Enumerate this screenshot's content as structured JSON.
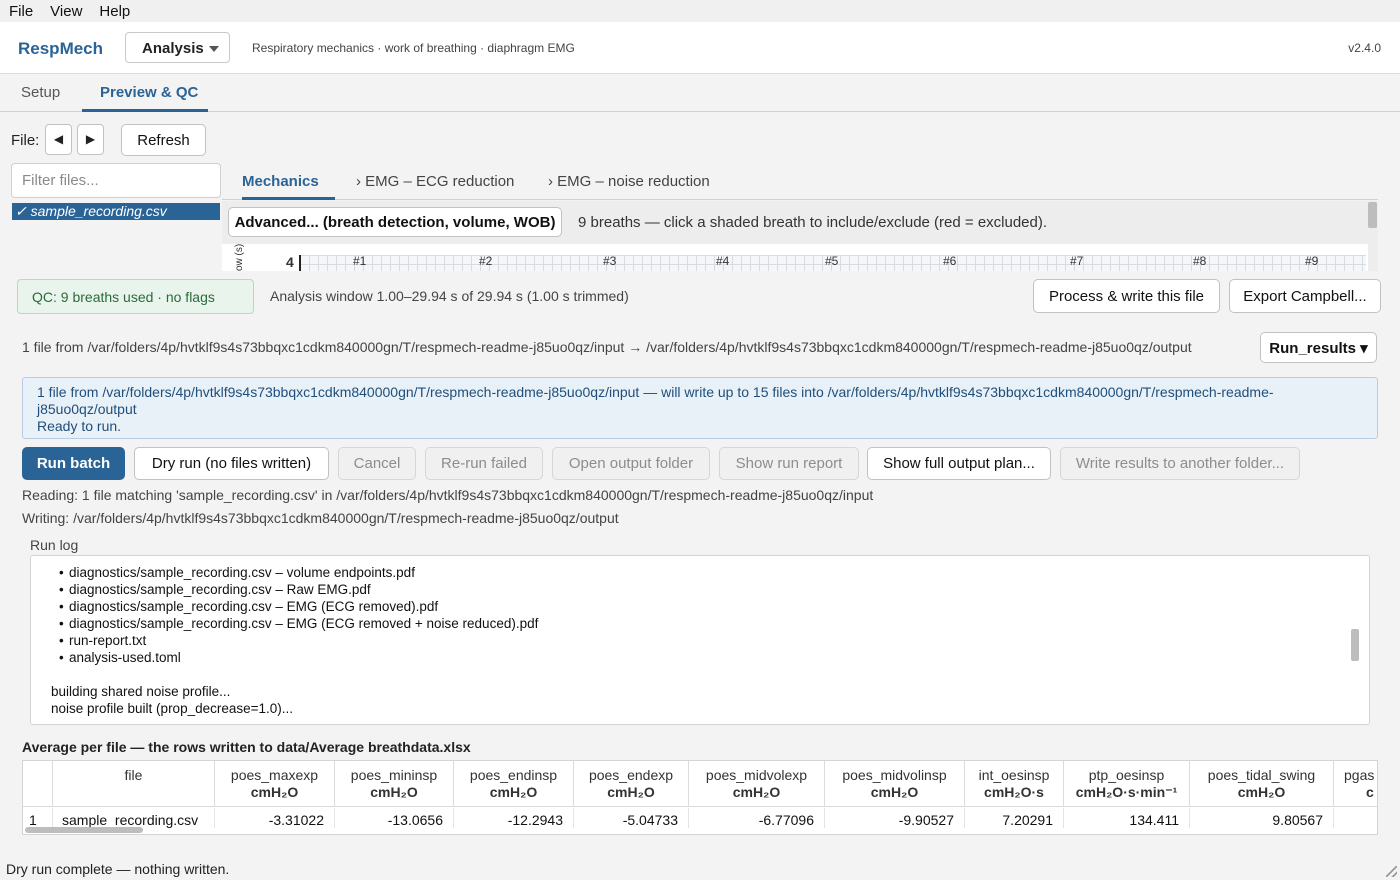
{
  "menu": {
    "items": [
      "File",
      "View",
      "Help"
    ]
  },
  "header": {
    "brand": "RespMech",
    "mode": "Analysis",
    "subtitle": "Respiratory mechanics · work of breathing · diaphragm EMG",
    "version": "v2.4.0"
  },
  "tabs": [
    "Setup",
    "Preview & QC"
  ],
  "file_nav": {
    "label": "File:",
    "prev_icon": "◀",
    "next_icon": "▶",
    "refresh": "Refresh"
  },
  "filter": {
    "placeholder": "Filter files..."
  },
  "files": [
    {
      "name": "✓ sample_recording.csv",
      "selected": true
    }
  ],
  "subtabs": [
    "Mechanics",
    "› EMG – ECG reduction",
    "› EMG – noise reduction"
  ],
  "mechanics": {
    "advanced_button": "Advanced... (breath detection, volume, WOB)",
    "breath_hint": "9 breaths — click a shaded breath to include/exclude (red = excluded).",
    "plot_ylabel": "ow (s)",
    "plot_tick": "4",
    "breath_labels": [
      "#1",
      "#2",
      "#3",
      "#4",
      "#5",
      "#6",
      "#7",
      "#8",
      "#9"
    ]
  },
  "qc": {
    "badge": "QC:  9 breaths used  · no flags",
    "window": "Analysis window 1.00–29.94 s of 29.94 s (1.00 s trimmed)",
    "process_button": "Process & write this file",
    "export_button": "Export Campbell..."
  },
  "batch": {
    "plan_text": "1 file from /var/folders/4p/hvtklf9s4s73bbqxc1cdkm840000gn/T/respmech-readme-j85uo0qz/input → /var/folders/4p/hvtklf9s4s73bbqxc1cdkm840000gn/T/respmech-readme-j85uo0qz/output",
    "run_results_button": "Run_results ▾",
    "info_line1": "1 file from /var/folders/4p/hvtklf9s4s73bbqxc1cdkm840000gn/T/respmech-readme-j85uo0qz/input — will write up to 15 files into /var/folders/4p/hvtklf9s4s73bbqxc1cdkm840000gn/T/respmech-readme-j85uo0qz/output",
    "info_line2": "Ready to run.",
    "buttons": {
      "run": "Run batch",
      "dry_run": "Dry run (no files written)",
      "cancel": "Cancel",
      "rerun_failed": "Re-run failed",
      "open_output": "Open output folder",
      "show_report": "Show run report",
      "show_plan": "Show full output plan...",
      "write_other": "Write results to another folder..."
    },
    "reading": "Reading: 1 file matching 'sample_recording.csv' in /var/folders/4p/hvtklf9s4s73bbqxc1cdkm840000gn/T/respmech-readme-j85uo0qz/input",
    "writing": "Writing: /var/folders/4p/hvtklf9s4s73bbqxc1cdkm840000gn/T/respmech-readme-j85uo0qz/output"
  },
  "runlog": {
    "label": "Run log",
    "bullets": [
      "diagnostics/sample_recording.csv – volume endpoints.pdf",
      "diagnostics/sample_recording.csv – Raw EMG.pdf",
      "diagnostics/sample_recording.csv – EMG (ECG removed).pdf",
      "diagnostics/sample_recording.csv – EMG (ECG removed + noise reduced).pdf",
      "run-report.txt",
      "analysis-used.toml"
    ],
    "lines": [
      "building shared noise profile...",
      "noise profile built (prop_decrease=1.0)..."
    ]
  },
  "table": {
    "title": "Average per file — the rows written to data/Average breathdata.xlsx",
    "columns": [
      {
        "name": "file",
        "unit": ""
      },
      {
        "name": "poes_maxexp",
        "unit": "cmH₂O"
      },
      {
        "name": "poes_mininsp",
        "unit": "cmH₂O"
      },
      {
        "name": "poes_endinsp",
        "unit": "cmH₂O"
      },
      {
        "name": "poes_endexp",
        "unit": "cmH₂O"
      },
      {
        "name": "poes_midvolexp",
        "unit": "cmH₂O"
      },
      {
        "name": "poes_midvolinsp",
        "unit": "cmH₂O"
      },
      {
        "name": "int_oesinsp",
        "unit": "cmH₂O·s"
      },
      {
        "name": "ptp_oesinsp",
        "unit": "cmH₂O·s·min⁻¹"
      },
      {
        "name": "poes_tidal_swing",
        "unit": "cmH₂O"
      },
      {
        "name": "pgas",
        "unit": "c"
      }
    ],
    "rows": [
      {
        "index": "1",
        "cells": [
          "sample_recording.csv",
          "-3.31022",
          "-13.0656",
          "-12.2943",
          "-5.04733",
          "-6.77096",
          "-9.90527",
          "7.20291",
          "134.411",
          "9.80567",
          ""
        ]
      }
    ]
  },
  "status": {
    "text": "Dry run complete — nothing written."
  }
}
